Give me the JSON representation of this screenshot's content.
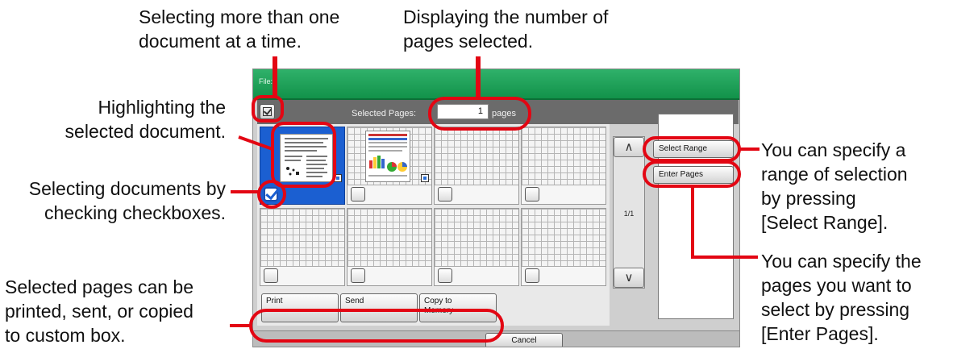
{
  "callouts": {
    "multi_select": "Selecting more than one\ndocument at a time.",
    "page_count": "Displaying the number of\npages selected.",
    "highlight": "Highlighting the\nselected document.",
    "checkbox": "Selecting documents by\nchecking checkboxes.",
    "actions": "Selected pages can be\nprinted, sent, or copied\nto custom box.",
    "select_range": "You can specify a\nrange of selection\nby pressing\n[Select Range].",
    "enter_pages": "You can specify the\npages you want to\nselect by pressing\n[Enter Pages]."
  },
  "panel": {
    "title": "File:",
    "selected_label": "Selected Pages:",
    "selected_count": "1",
    "selected_unit": "pages",
    "page_indicator": "1/1",
    "select_range": "Select Range",
    "enter_pages": "Enter Pages",
    "print": "Print",
    "send": "Send",
    "copy_to_memory": "Copy to\nMemory",
    "cancel": "Cancel"
  },
  "colors": {
    "titlebar": "#1aa155",
    "selected_tile": "#1b5fd1",
    "annotation": "#e30613"
  },
  "tiles": [
    {
      "selected": true,
      "checked": true,
      "thumbnail": "text-page"
    },
    {
      "selected": false,
      "checked": false,
      "thumbnail": "chart-page"
    },
    {
      "selected": false,
      "checked": false,
      "thumbnail": "empty"
    },
    {
      "selected": false,
      "checked": false,
      "thumbnail": "empty"
    },
    {
      "selected": false,
      "checked": false,
      "thumbnail": "empty"
    },
    {
      "selected": false,
      "checked": false,
      "thumbnail": "empty"
    },
    {
      "selected": false,
      "checked": false,
      "thumbnail": "empty"
    },
    {
      "selected": false,
      "checked": false,
      "thumbnail": "empty"
    }
  ]
}
